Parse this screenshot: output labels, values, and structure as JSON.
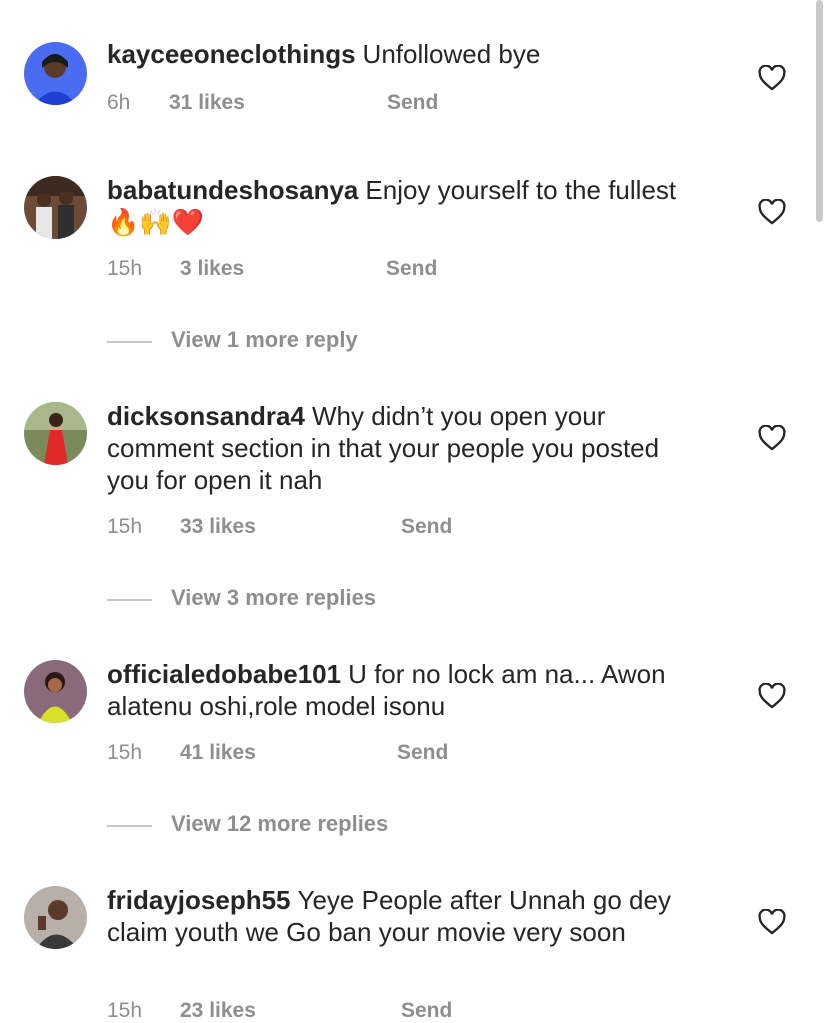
{
  "comments": [
    {
      "username": "kayceeoneclothings",
      "text": "Unfollowed bye",
      "time": "6h",
      "likes": "31 likes",
      "reply_label": "Send",
      "avatar_icon": "user-avatar-blue"
    },
    {
      "username": "babatundeshosanya",
      "text": "Enjoy yourself to the fullest 🔥🙌❤️",
      "time": "15h",
      "likes": "3 likes",
      "reply_label": "Send",
      "view_replies": "View 1 more reply",
      "avatar_icon": "user-avatar-group"
    },
    {
      "username": "dicksonsandra4",
      "text": "Why didn’t you open your comment section in that your people you posted you for open it nah",
      "time": "15h",
      "likes": "33 likes",
      "reply_label": "Send",
      "view_replies": "View 3 more replies",
      "avatar_icon": "user-avatar-red-dress"
    },
    {
      "username": "officialedobabe101",
      "text": "U for no lock am na... Awon alatenu oshi,role model isonu",
      "time": "15h",
      "likes": "41 likes",
      "reply_label": "Send",
      "view_replies": "View 12 more replies",
      "avatar_icon": "user-avatar-yellow"
    },
    {
      "username": "fridayjoseph55",
      "text": "Yeye People after Unnah go dey claim youth we Go ban your movie very soon",
      "time": "15h",
      "likes": "23 likes",
      "reply_label": "Send",
      "avatar_icon": "user-avatar-man"
    }
  ],
  "icons": {
    "like": "heart-outline-icon"
  },
  "colors": {
    "text": "#262626",
    "secondary": "#8e8e8e"
  }
}
